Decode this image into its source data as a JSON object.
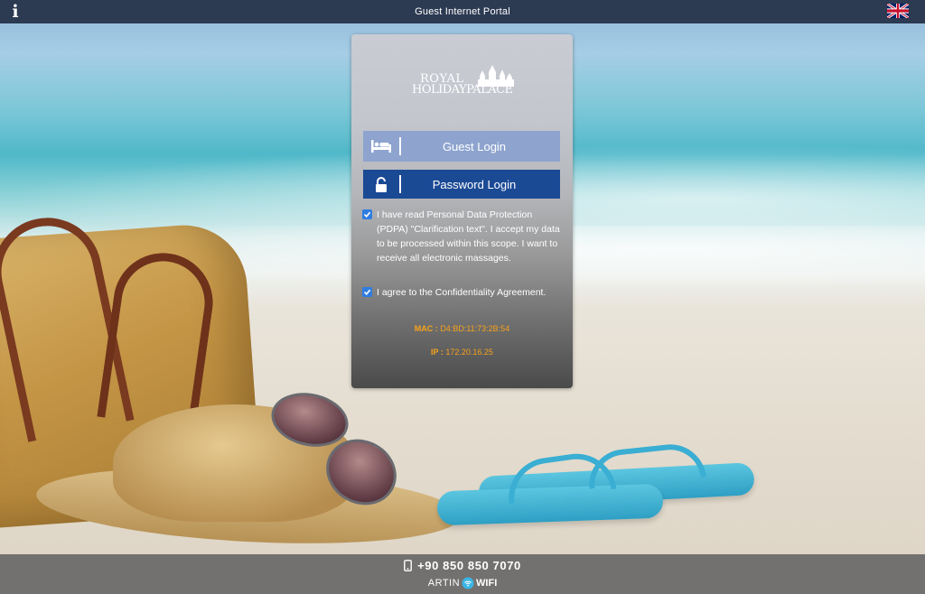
{
  "topbar": {
    "title": "Guest Internet Portal",
    "info_icon": "info-icon",
    "language_flag": "uk-flag-icon"
  },
  "logo": {
    "line1": "ROYAL",
    "line2": "HOLIDAYPALACE"
  },
  "login": {
    "guest_label": "Guest Login",
    "guest_icon": "bed-icon",
    "password_label": "Password Login",
    "password_icon": "unlock-icon"
  },
  "consents": [
    {
      "checked": true,
      "text": "I have read Personal Data Protection (PDPA) \"Clarification text\". I accept my data to be processed within this scope. I want to receive all electronic massages."
    },
    {
      "checked": true,
      "text": "I agree to the Confidentiality Agreement."
    }
  ],
  "network": {
    "mac_label": "MAC :",
    "mac_value": "D4:BD:11:73:2B:54",
    "ip_label": "IP :",
    "ip_value": "172.20.16.25"
  },
  "footer": {
    "phone": "+90 850 850 7070",
    "phone_icon": "mobile-phone-icon",
    "brand_part1": "ARTIN",
    "brand_part2": "WIFI"
  },
  "colors": {
    "topbar": "#2c3a52",
    "guest_button": "#8ea4cf",
    "password_button": "#1b4a95",
    "net_info": "#f7a21b",
    "checkbox": "#2f7de1"
  }
}
